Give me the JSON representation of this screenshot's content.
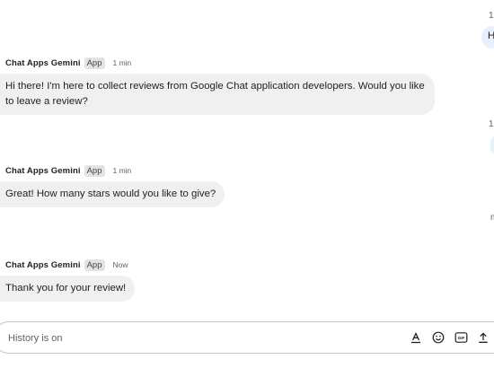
{
  "right_edge": {
    "clip_1": "1",
    "clip_bubble_1": "H",
    "clip_2": "1",
    "clip_3": "m"
  },
  "messages": [
    {
      "sender": "Chat Apps Gemini",
      "badge": "App",
      "time": "1 min",
      "text": "Hi there! I'm here to collect reviews from Google Chat application developers. Would you like to leave a review?"
    },
    {
      "sender": "Chat Apps Gemini",
      "badge": "App",
      "time": "1 min",
      "text": "Great! How many stars would you like to give?"
    },
    {
      "sender": "Chat Apps Gemini",
      "badge": "App",
      "time": "Now",
      "text": "Thank you for your review!"
    }
  ],
  "composer": {
    "placeholder": "History is on",
    "tools": [
      "format-text-icon",
      "emoji-icon",
      "gif-icon",
      "upload-icon"
    ]
  },
  "colors": {
    "bubble_bg": "#f0f0f0",
    "badge_bg": "#e3e3e3",
    "user_bubble_bg": "#e8f0fe",
    "border": "#c4c7c5"
  }
}
